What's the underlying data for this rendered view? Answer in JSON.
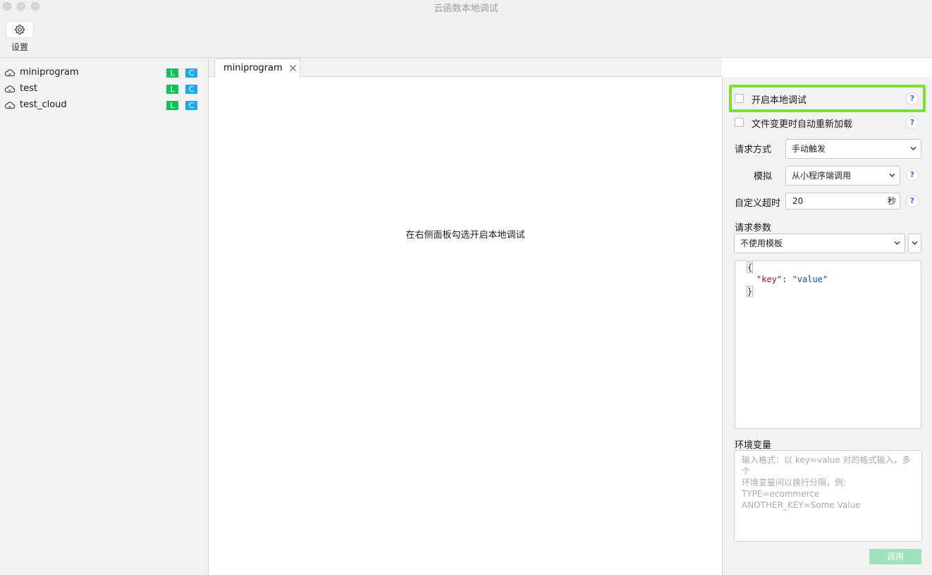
{
  "window": {
    "title": "云函数本地调试"
  },
  "toolbar": {
    "settings_label": "设置"
  },
  "functions": [
    {
      "name": "miniprogram",
      "badges": [
        "L",
        "C"
      ]
    },
    {
      "name": "test",
      "badges": [
        "L",
        "C"
      ]
    },
    {
      "name": "test_cloud",
      "badges": [
        "L",
        "C"
      ]
    }
  ],
  "tabs": [
    {
      "label": "miniprogram"
    }
  ],
  "center": {
    "message": "在右侧面板勾选开启本地调试"
  },
  "panel": {
    "enable_local_debug": {
      "label": "开启本地调试",
      "checked": false,
      "help": "?"
    },
    "auto_reload": {
      "label": "文件变更时自动重新加载",
      "checked": false,
      "help": "?"
    },
    "request_mode": {
      "label": "请求方式",
      "value": "手动触发"
    },
    "simulate": {
      "label": "模拟",
      "value": "从小程序端调用",
      "help": "?"
    },
    "timeout": {
      "label": "自定义超时",
      "value": "20",
      "unit": "秒",
      "help": "?"
    },
    "request_params": {
      "label": "请求参数",
      "template": "不使用模板"
    },
    "editor": {
      "open_brace": "{",
      "key": "\"key\"",
      "colon": ": ",
      "value": "\"value\"",
      "close_brace": "}"
    },
    "env_vars": {
      "label": "环境变量",
      "placeholder_lines": [
        "输入格式：以 key=value 对的格式输入，多个",
        "环境变量间以换行分隔，例:",
        "TYPE=ecommerce",
        "ANOTHER_KEY=Some Value"
      ]
    },
    "invoke_label": "调用"
  },
  "colors": {
    "highlight": "#7be12b",
    "badge_l": "#0fc15a",
    "badge_c": "#19a9f0",
    "invoke_disabled": "#9fe1bb"
  }
}
